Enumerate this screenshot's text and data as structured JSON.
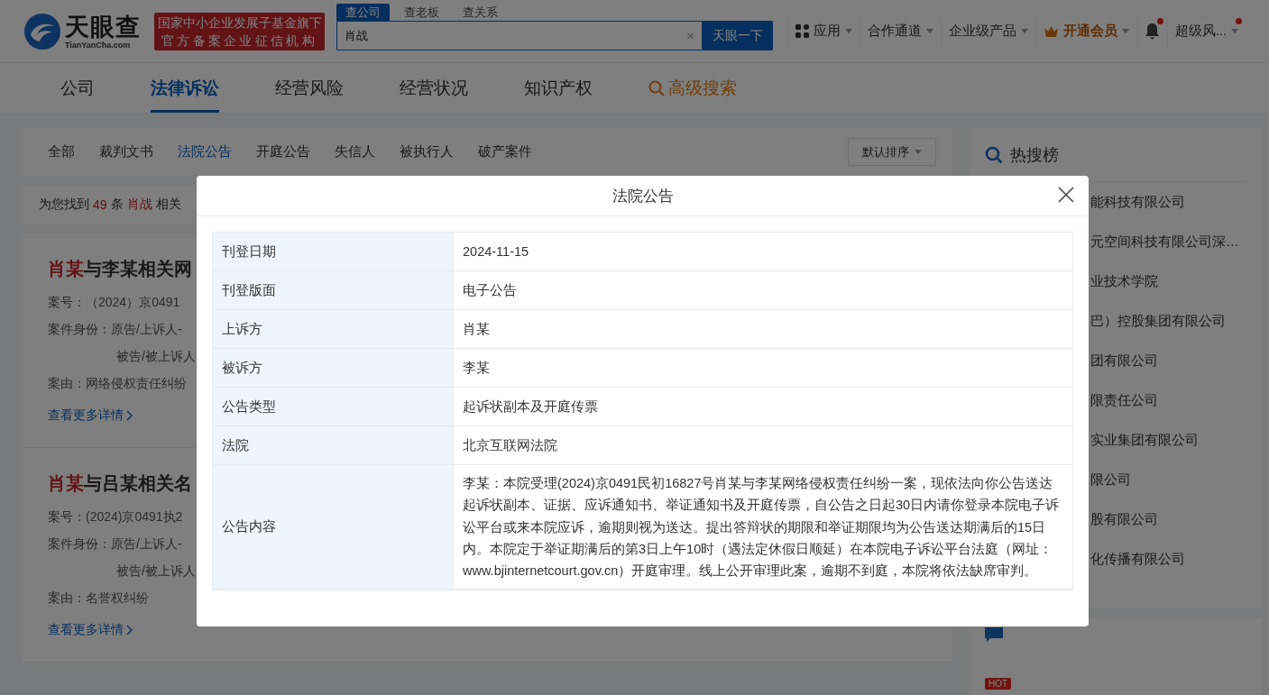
{
  "header": {
    "logo": {
      "name": "天眼查",
      "domain": "TianYanCha.com"
    },
    "badge": [
      "国家中小企业发展子基金旗下",
      "官方备案企业征信机构"
    ],
    "search": {
      "tabs": [
        {
          "label": "查公司",
          "selected": true
        },
        {
          "label": "查老板",
          "selected": false
        },
        {
          "label": "查关系",
          "selected": false
        }
      ],
      "value": "肖战",
      "clear": "×",
      "button": "天眼一下"
    },
    "menu": [
      {
        "kind": "apps",
        "label": "应用",
        "dot": false
      },
      {
        "kind": "plain",
        "label": "合作通道",
        "dot": false
      },
      {
        "kind": "plain",
        "label": "企业级产品",
        "dot": false
      },
      {
        "kind": "vip",
        "label": "开通会员",
        "dot": false
      },
      {
        "kind": "bell",
        "dot": true
      },
      {
        "kind": "user",
        "label": "超级风...",
        "dot": true
      }
    ]
  },
  "main_tabs": [
    {
      "kind": "tab",
      "label": "公司",
      "selected": false
    },
    {
      "kind": "tab",
      "label": "法律诉讼",
      "selected": true
    },
    {
      "kind": "tab",
      "label": "经营风险",
      "selected": false
    },
    {
      "kind": "tab",
      "label": "经营状况",
      "selected": false
    },
    {
      "kind": "tab",
      "label": "知识产权",
      "selected": false
    },
    {
      "kind": "advanced",
      "label": "高级搜索",
      "selected": false
    }
  ],
  "sub_tabs": [
    {
      "label": "全部",
      "selected": false
    },
    {
      "label": "裁判文书",
      "selected": false
    },
    {
      "label": "法院公告",
      "selected": true
    },
    {
      "label": "开庭公告",
      "selected": false
    },
    {
      "label": "失信人",
      "selected": false
    },
    {
      "label": "被执行人",
      "selected": false
    },
    {
      "label": "破产案件",
      "selected": false
    }
  ],
  "sort": "默认排序",
  "result_count": {
    "prefix": "为您找到",
    "count": "49",
    "unit": "条",
    "keyword": "肖战",
    "suffix": "相关"
  },
  "cases": [
    {
      "title_highlight": "肖某",
      "title_rest": "与李某相关网",
      "lines": [
        "案号：（2024）京0491",
        "案件身份：原告/上诉人-",
        "被告/被上诉人",
        "案由：网络侵权责任纠纷"
      ],
      "link": "查看更多详情"
    },
    {
      "title_highlight": "肖某",
      "title_rest": "与吕某相关名",
      "lines": [
        "案号：(2024)京0491执2",
        "案件身份：原告/上诉人-",
        "被告/被上诉人",
        "案由：名誉权纠纷"
      ],
      "link": "查看更多详情"
    }
  ],
  "hot_search": {
    "title": "热搜榜",
    "items": [
      "能科技有限公司",
      "元空间科技有限公司深…",
      "业技术学院",
      "巴）控股集团有限公司",
      "团有限公司",
      "限责任公司",
      "实业集团有限公司",
      "限公司",
      "股有限公司",
      "化传播有限公司"
    ]
  },
  "hot_topics": {
    "badge": "HOT"
  },
  "dialog": {
    "title": "法院公告",
    "rows": [
      {
        "label": "刊登日期",
        "value": "2024-11-15"
      },
      {
        "label": "刊登版面",
        "value": "电子公告"
      },
      {
        "label": "上诉方",
        "value": "肖某"
      },
      {
        "label": "被诉方",
        "value": "李某"
      },
      {
        "label": "公告类型",
        "value": "起诉状副本及开庭传票"
      },
      {
        "label": "法院",
        "value": "北京互联网法院"
      },
      {
        "label": "公告内容",
        "value": "李某：本院受理(2024)京0491民初16827号肖某与李某网络侵权责任纠纷一案，现依法向你公告送达起诉状副本、证据、应诉通知书、举证通知书及开庭传票，自公告之日起30日内请你登录本院电子诉讼平台或来本院应诉，逾期则视为送达。提出答辩状的期限和举证期限均为公告送达期满后的15日内。本院定于举证期满后的第3日上午10时（遇法定休假日顺延）在本院电子诉讼平台法庭（网址：www.bjinternetcourt.gov.cn）开庭审理。线上公开审理此案，逾期不到庭，本院将依法缺席审判。"
      }
    ]
  }
}
